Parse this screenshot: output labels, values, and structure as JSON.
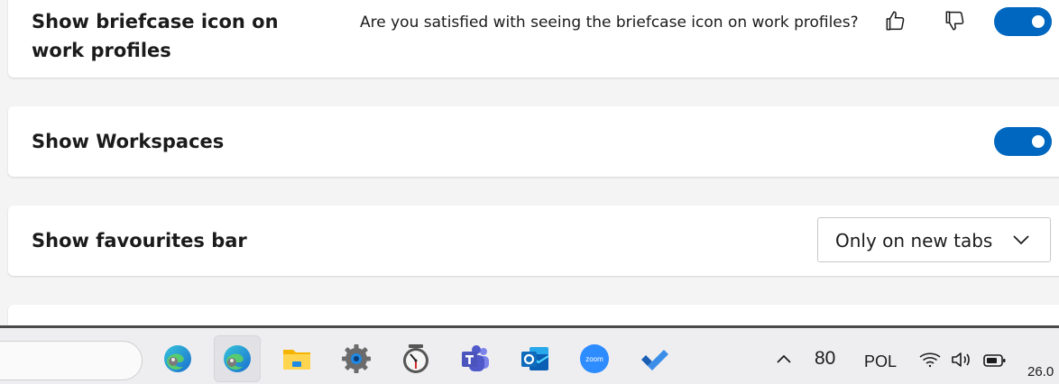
{
  "settings": {
    "briefcase": {
      "title": "Show briefcase icon on work profiles",
      "question": "Are you satisfied with seeing the briefcase icon on work profiles?",
      "toggle_on": true
    },
    "workspaces": {
      "title": "Show Workspaces",
      "toggle_on": true
    },
    "favourites": {
      "title": "Show favourites bar",
      "selected": "Only on new tabs"
    }
  },
  "taskbar": {
    "apps": [
      {
        "name": "Microsoft Edge",
        "icon": "edge-icon"
      },
      {
        "name": "Microsoft Edge (profile)",
        "icon": "edge-profile-icon",
        "active": true
      },
      {
        "name": "File Explorer",
        "icon": "folder-icon"
      },
      {
        "name": "Settings",
        "icon": "gear-icon"
      },
      {
        "name": "Clock",
        "icon": "clock-icon"
      },
      {
        "name": "Microsoft Teams",
        "icon": "teams-icon"
      },
      {
        "name": "Outlook",
        "icon": "outlook-icon"
      },
      {
        "name": "Zoom",
        "icon": "zoom-icon",
        "label": "zoom"
      },
      {
        "name": "Microsoft To Do",
        "icon": "todo-icon"
      }
    ],
    "tray": {
      "temperature": "80",
      "language": "POL",
      "date_partial": "26.0"
    }
  },
  "colors": {
    "accent": "#0067c0",
    "card_bg": "#ffffff",
    "page_bg": "#f4f4f4",
    "taskbar_bg": "#eeeef0"
  }
}
